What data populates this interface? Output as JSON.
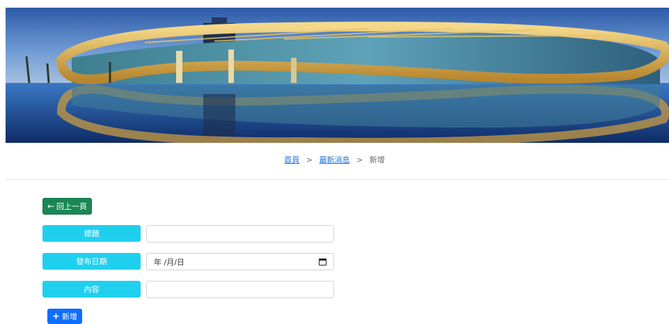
{
  "banner": {
    "image": "architecture-banner"
  },
  "breadcrumb": {
    "home": "首頁",
    "news": "最新消息",
    "current": "新增",
    "separator": ">"
  },
  "back_button": {
    "label": "回上一頁",
    "icon": "arrow-left-icon"
  },
  "form": {
    "title_label": "標題",
    "title_value": "",
    "date_label": "發布日期",
    "date_placeholder": "年 /月/日",
    "content_label": "內容",
    "content_value": ""
  },
  "add_button": {
    "label": "新增",
    "icon": "plus-icon"
  },
  "colors": {
    "back_button": "#198754",
    "label_bg": "#1fd0ee",
    "add_button": "#0d6efd",
    "link": "#1a73e8"
  }
}
